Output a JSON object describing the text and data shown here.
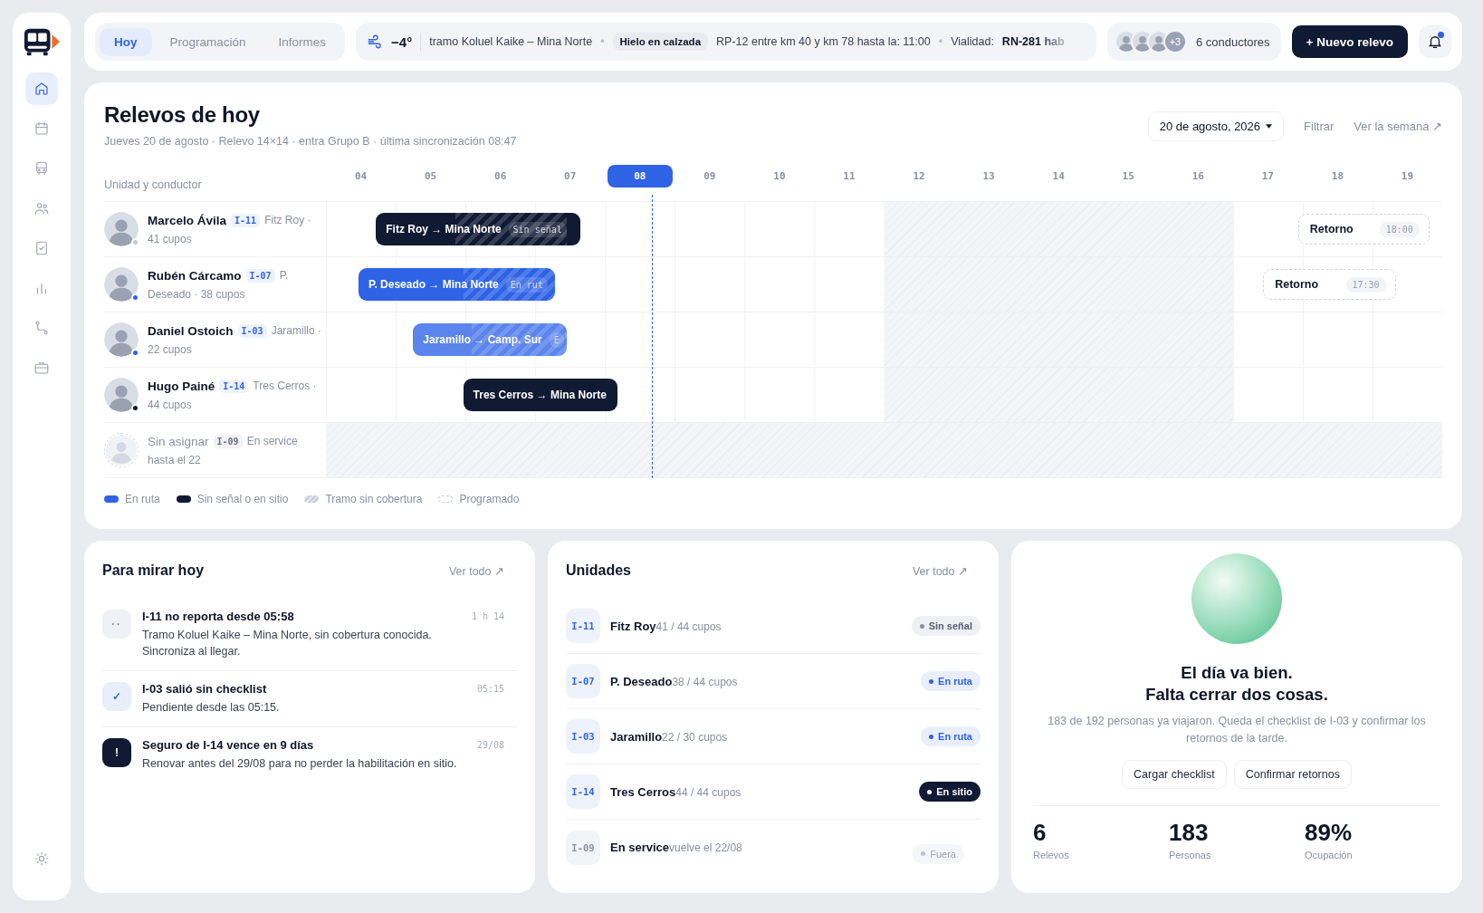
{
  "sidebar": {
    "items": [
      {
        "selected": true
      },
      {
        "selected": false
      },
      {
        "selected": false
      },
      {
        "selected": false
      },
      {
        "selected": false
      },
      {
        "selected": false
      },
      {
        "selected": false
      },
      {
        "selected": false
      }
    ]
  },
  "top_bar": {
    "tabs": [
      {
        "label": "Hoy",
        "selected": true
      },
      {
        "label": "Programación",
        "selected": false
      },
      {
        "label": "Informes",
        "selected": false
      }
    ],
    "weather": {
      "temperature": "−4°"
    },
    "ticker": [
      {
        "kind": "text",
        "text": "tramo Koluel Kaike – Mina Norte"
      },
      {
        "kind": "sep",
        "text": "•"
      },
      {
        "kind": "badge",
        "text": "Hielo en calzada"
      },
      {
        "kind": "text",
        "text": "RP-12 entre km 40 y km 78 hasta la: 11:00"
      },
      {
        "kind": "sep",
        "text": "•"
      },
      {
        "kind": "text",
        "text": "Vialidad:"
      },
      {
        "kind": "strong",
        "text": "RN-281 hab"
      }
    ],
    "crew": {
      "avatars": [
        {
          "kind": "photo"
        },
        {
          "kind": "photo"
        },
        {
          "kind": "photo"
        }
      ],
      "more": "+3",
      "label": "6 conductores"
    },
    "new_button": "+ Nuevo relevo",
    "notifications": {
      "unread": true
    }
  },
  "timeline": {
    "title": "Relevos de hoy",
    "subtitle": "Jueves 20 de agosto · Relevo 14×14 · entra Grupo B · última sincronización 08:47",
    "date_picker": "20 de agosto, 2026",
    "filter": "Filtrar",
    "week_link": "Ver la semana ↗",
    "column_header": "Unidad y conductor",
    "hours": [
      {
        "label": "04",
        "selected": false
      },
      {
        "label": "05",
        "selected": false
      },
      {
        "label": "06",
        "selected": false
      },
      {
        "label": "07",
        "selected": false
      },
      {
        "label": "08",
        "selected": true
      },
      {
        "label": "09",
        "selected": false
      },
      {
        "label": "10",
        "selected": false
      },
      {
        "label": "11",
        "selected": false
      },
      {
        "label": "12",
        "selected": false
      },
      {
        "label": "13",
        "selected": false
      },
      {
        "label": "14",
        "selected": false
      },
      {
        "label": "15",
        "selected": false
      },
      {
        "label": "16",
        "selected": false
      },
      {
        "label": "17",
        "selected": false
      },
      {
        "label": "18",
        "selected": false
      },
      {
        "label": "19",
        "selected": false
      }
    ],
    "rows": [
      {
        "kind": "driver",
        "name": "Marcelo Ávila",
        "unit": "I-11",
        "place": "Fitz Roy ·",
        "seats": "41 cupos",
        "color": "#c3c7d0",
        "bar": {
          "kind": "dark",
          "label": "Fitz Roy → Mina Norte",
          "tag": "Sin señal"
        },
        "return": {
          "label": "Retorno",
          "time": "18:00"
        }
      },
      {
        "kind": "driver",
        "name": "Rubén Cárcamo",
        "unit": "I-07",
        "place": "P.",
        "seats": "Deseado · 38 cupos",
        "color": "#2f63e6",
        "bar": {
          "kind": "blue",
          "label": "P. Deseado → Mina Norte",
          "tag": "En rut"
        },
        "return": {
          "label": "Retorno",
          "time": "17:30"
        }
      },
      {
        "kind": "driver",
        "name": "Daniel Ostoich",
        "unit": "I-03",
        "place": "Jaramillo ·",
        "seats": "22 cupos",
        "color": "#2f63e6",
        "bar": {
          "kind": "soft_blue",
          "label": "Jaramillo → Camp. Sur",
          "tag": "E"
        }
      },
      {
        "kind": "driver",
        "name": "Hugo Painé",
        "unit": "I-14",
        "place": "Tres Cerros ·",
        "seats": "44 cupos",
        "color": "#111a33",
        "bar": {
          "kind": "dark",
          "label": "Tres Cerros → Mina Norte"
        }
      },
      {
        "kind": "unassigned",
        "name": "Sin asignar",
        "unit": "I-09",
        "place": "En service",
        "seats": "hasta el 22"
      }
    ],
    "legend": [
      {
        "kind": "blue",
        "label": "En ruta"
      },
      {
        "kind": "dark",
        "label": "Sin señal o en sitio"
      },
      {
        "kind": "hatched",
        "label": "Tramo sin cobertura"
      },
      {
        "kind": "dashed",
        "label": "Programado"
      }
    ]
  },
  "watch": {
    "title": "Para mirar hoy",
    "link": "Ver todo ↗",
    "items": [
      {
        "kind": "signal",
        "icon_text": "··",
        "title": "I-11 no reporta desde 05:58",
        "body": "Tramo Koluel Kaike – Mina Norte, sin cobertura conocida. Sincroniza al llegar.",
        "time": "1 h 14"
      },
      {
        "kind": "check",
        "icon_text": "✓",
        "title": "I-03 salió sin checklist",
        "body": "Pendiente desde las 05:15.",
        "time": "05:15"
      },
      {
        "kind": "alert",
        "icon_text": "!",
        "title": "Seguro de I-14 vence en 9 días",
        "body": "Renovar antes del 29/08 para no perder la habilitación en sitio.",
        "time": "29/08"
      }
    ]
  },
  "units": {
    "title": "Unidades",
    "link": "Ver todo ↗",
    "items": [
      {
        "code": "I-11",
        "name": "Fitz Roy",
        "detail": "41 / 44 cupos",
        "status": {
          "kind": "sin_senal",
          "label": "Sin señal"
        }
      },
      {
        "code": "I-07",
        "name": "P. Deseado",
        "detail": "38 / 44 cupos",
        "status": {
          "kind": "en_ruta",
          "label": "En ruta"
        }
      },
      {
        "code": "I-03",
        "name": "Jaramillo",
        "detail": "22 / 30 cupos",
        "status": {
          "kind": "en_ruta",
          "label": "En ruta"
        }
      },
      {
        "code": "I-14",
        "name": "Tres Cerros",
        "detail": "44 / 44 cupos",
        "status": {
          "kind": "en_sitio",
          "label": "En sitio"
        }
      },
      {
        "code": "I-09",
        "name": "En service",
        "detail": "vuelve el 22/08",
        "status": {
          "kind": "fuera",
          "label": "Fuera"
        }
      }
    ]
  },
  "summary": {
    "headline": [
      "El día va bien.",
      "Falta cerrar dos cosas."
    ],
    "description": "183 de 192 personas ya viajaron. Queda el checklist de I-03 y confirmar los retornos de la tarde.",
    "buttons": [
      "Cargar checklist",
      "Confirmar retornos"
    ],
    "stats": [
      {
        "value": "6",
        "label": "Relevos"
      },
      {
        "value": "183",
        "label": "Personas"
      },
      {
        "value": "89%",
        "label": "Ocupación"
      }
    ]
  }
}
